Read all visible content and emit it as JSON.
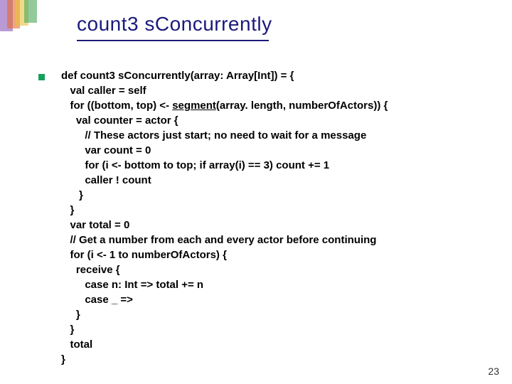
{
  "title": "count3 sConcurrently",
  "code": {
    "l0": "def count3 sConcurrently(array: Array[Int]) = {",
    "l1": "   val caller = self",
    "l2a": "   for ((bottom, top) <- ",
    "l2b": "segment",
    "l2c": "(array. length, numberOfActors)) {",
    "l3": "     val counter = actor {",
    "l4": "        // These actors just start; no need to wait for a message",
    "l5": "        var count = 0",
    "l6": "        for (i <- bottom to top; if array(i) == 3) count += 1",
    "l7": "        caller ! count",
    "l8": "      }",
    "l9": "   }",
    "l10": "   var total = 0",
    "l11": "   // Get a number from each and every actor before continuing",
    "l12": "   for (i <- 1 to numberOfActors) {",
    "l13": "     receive {",
    "l14": "        case n: Int => total += n",
    "l15": "        case _ =>",
    "l16": "     }",
    "l17": "   }",
    "l18": "   total",
    "l19": "}"
  },
  "pagenum": "23"
}
